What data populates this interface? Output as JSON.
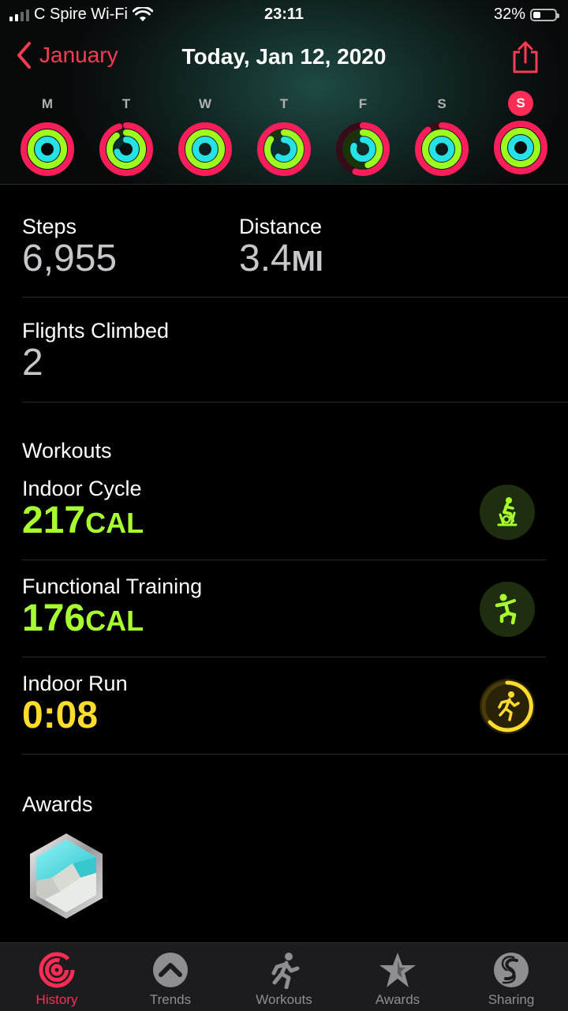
{
  "status": {
    "carrier": "C Spire Wi-Fi",
    "time": "23:11",
    "battery": "32%"
  },
  "nav": {
    "back_label": "January",
    "title": "Today, Jan 12, 2020"
  },
  "week": [
    {
      "day": "M",
      "move": 1.0,
      "exercise": 1.0,
      "stand": 1.0
    },
    {
      "day": "T",
      "move": 0.95,
      "exercise": 0.9,
      "stand": 0.7
    },
    {
      "day": "W",
      "move": 1.0,
      "exercise": 1.0,
      "stand": 1.0
    },
    {
      "day": "T",
      "move": 1.0,
      "exercise": 0.85,
      "stand": 0.6
    },
    {
      "day": "F",
      "move": 0.55,
      "exercise": 0.45,
      "stand": 0.8
    },
    {
      "day": "S",
      "move": 0.9,
      "exercise": 1.0,
      "stand": 1.0
    },
    {
      "day": "S",
      "move": 1.0,
      "exercise": 1.0,
      "stand": 1.0,
      "today": true
    }
  ],
  "stats": {
    "steps_label": "Steps",
    "steps_value": "6,955",
    "distance_label": "Distance",
    "distance_value": "3.4",
    "distance_unit": "MI",
    "flights_label": "Flights Climbed",
    "flights_value": "2"
  },
  "workouts": {
    "heading": "Workouts",
    "items": [
      {
        "name": "Indoor Cycle",
        "value": "217",
        "unit": "CAL",
        "color": "#a8ff2f",
        "icon": "indoor-cycle-icon"
      },
      {
        "name": "Functional Training",
        "value": "176",
        "unit": "CAL",
        "color": "#a8ff2f",
        "icon": "functional-training-icon"
      },
      {
        "name": "Indoor Run",
        "value": "0:08",
        "unit": "",
        "color": "#ffdc2e",
        "icon": "indoor-run-icon"
      }
    ]
  },
  "awards": {
    "heading": "Awards",
    "badge": "award-badge"
  },
  "tabs": [
    {
      "label": "History",
      "icon": "history-icon",
      "active": true
    },
    {
      "label": "Trends",
      "icon": "trends-icon"
    },
    {
      "label": "Workouts",
      "icon": "workouts-icon"
    },
    {
      "label": "Awards",
      "icon": "awards-icon"
    },
    {
      "label": "Sharing",
      "icon": "sharing-icon"
    }
  ],
  "colors": {
    "move": "#fa1e5a",
    "exercise": "#9dff1e",
    "stand": "#26e2e6",
    "accent": "#ff2d55"
  }
}
